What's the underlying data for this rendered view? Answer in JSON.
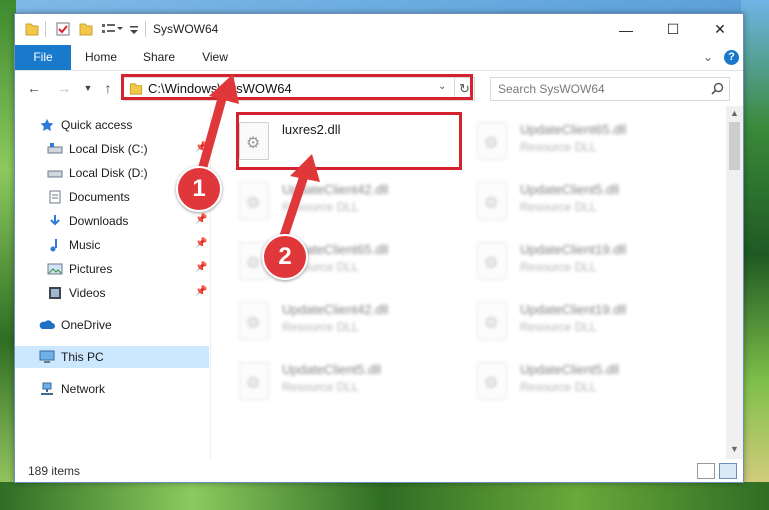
{
  "window": {
    "title": "SysWOW64"
  },
  "controls": {
    "minimize": "—",
    "maximize": "☐",
    "close": "✕"
  },
  "ribbon": {
    "tabs": [
      "File",
      "Home",
      "Share",
      "View"
    ],
    "expand": "⌄",
    "help": "?"
  },
  "address": {
    "path": "C:\\Windows\\SysWOW64",
    "search_placeholder": "Search SysWOW64"
  },
  "nav": {
    "items": [
      {
        "label": "Quick access",
        "icon": "star-icon",
        "pinned": false
      },
      {
        "label": "Local Disk (C:)",
        "icon": "drive-icon",
        "pinned": true
      },
      {
        "label": "Local Disk (D:)",
        "icon": "drive-icon",
        "pinned": false
      },
      {
        "label": "Documents",
        "icon": "documents-icon",
        "pinned": true
      },
      {
        "label": "Downloads",
        "icon": "download-icon",
        "pinned": true
      },
      {
        "label": "Music",
        "icon": "music-icon",
        "pinned": true
      },
      {
        "label": "Pictures",
        "icon": "pictures-icon",
        "pinned": true
      },
      {
        "label": "Videos",
        "icon": "videos-icon",
        "pinned": true
      },
      {
        "label": "OneDrive",
        "icon": "cloud-icon",
        "pinned": false
      },
      {
        "label": "This PC",
        "icon": "computer-icon",
        "pinned": false
      },
      {
        "label": "Network",
        "icon": "network-icon",
        "pinned": false
      }
    ]
  },
  "files": [
    {
      "name": "luxres2.dll",
      "type": "",
      "highlighted": true
    },
    {
      "name": "UpdateClient65.dll",
      "type": "Resource DLL",
      "highlighted": false
    },
    {
      "name": "UpdateClient42.dll",
      "type": "Resource DLL",
      "highlighted": false
    },
    {
      "name": "UpdateClient5.dll",
      "type": "Resource DLL",
      "highlighted": false
    },
    {
      "name": "UpdateClient65.dll",
      "type": "Resource DLL",
      "highlighted": false
    },
    {
      "name": "UpdateClient19.dll",
      "type": "Resource DLL",
      "highlighted": false
    },
    {
      "name": "UpdateClient42.dll",
      "type": "Resource DLL",
      "highlighted": false
    },
    {
      "name": "UpdateClient19.dll",
      "type": "Resource DLL",
      "highlighted": false
    },
    {
      "name": "UpdateClient5.dll",
      "type": "Resource DLL",
      "highlighted": false
    },
    {
      "name": "UpdateClient5.dll",
      "type": "Resource DLL",
      "highlighted": false
    }
  ],
  "status": {
    "count": "189 items"
  },
  "annotations": {
    "step1": "1",
    "step2": "2",
    "color": "#d5222f"
  }
}
